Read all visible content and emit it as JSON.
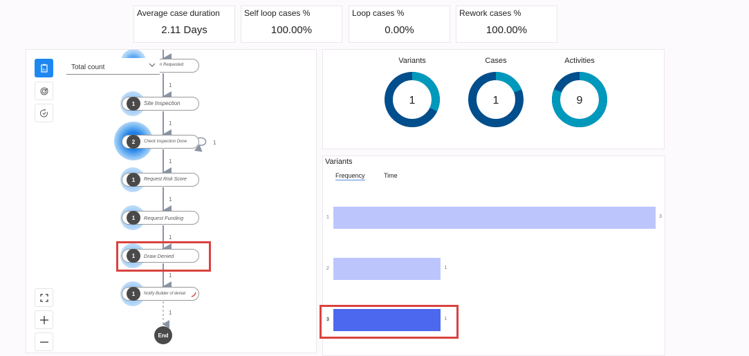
{
  "kpis": [
    {
      "title": "Average case duration",
      "value": "2.11 Days"
    },
    {
      "title": "Self loop cases %",
      "value": "100.00%"
    },
    {
      "title": "Loop cases %",
      "value": "0.00%"
    },
    {
      "title": "Rework cases %",
      "value": "100.00%"
    }
  ],
  "process_map": {
    "side_buttons": [
      {
        "icon": "report-icon",
        "active": true
      },
      {
        "icon": "target-icon",
        "active": false
      },
      {
        "icon": "timer-icon",
        "active": false
      }
    ],
    "dropdown": {
      "selected": "Total count"
    },
    "nodes": [
      {
        "label": "Inspection Requested",
        "count": "",
        "sublabel": "%"
      },
      {
        "label": "Site Inspection",
        "count": "1"
      },
      {
        "label": "Check Inspection Done",
        "count": "2",
        "self_loop": "1"
      },
      {
        "label": "Request Risk Score",
        "count": "1"
      },
      {
        "label": "Request Funding",
        "count": "1"
      },
      {
        "label": "Draw Denied",
        "count": "1",
        "highlighted": true
      },
      {
        "label": "Notify Builder of denial",
        "count": "1"
      }
    ],
    "edges": [
      "1",
      "1",
      "1",
      "1",
      "1",
      "1",
      "1"
    ],
    "end_label": "End",
    "zoom_controls": [
      "fit-screen-icon",
      "zoom-in-icon",
      "zoom-out-icon"
    ]
  },
  "summary": {
    "donuts": [
      {
        "title": "Variants",
        "value": "1",
        "light_fraction": 0.32,
        "light_start": 0
      },
      {
        "title": "Cases",
        "value": "1",
        "light_fraction": 0.19,
        "light_start": 0
      },
      {
        "title": "Activities",
        "value": "9",
        "light_fraction": 0.81,
        "light_start": 0
      }
    ],
    "colors": {
      "dark": "#004e8c",
      "light": "#0099bc"
    }
  },
  "variants_panel": {
    "title": "Variants",
    "tabs": [
      {
        "label": "Frequency",
        "active": true
      },
      {
        "label": "Time",
        "active": false
      }
    ]
  },
  "chart_data": {
    "type": "bar",
    "orientation": "horizontal",
    "title": "Variants",
    "categories": [
      "1",
      "2",
      "3"
    ],
    "values": [
      3,
      1,
      1
    ],
    "xlim": [
      0,
      3
    ],
    "selected_category": "3",
    "colors": {
      "default": "#bcc6fd",
      "selected": "#4b68ee"
    }
  }
}
